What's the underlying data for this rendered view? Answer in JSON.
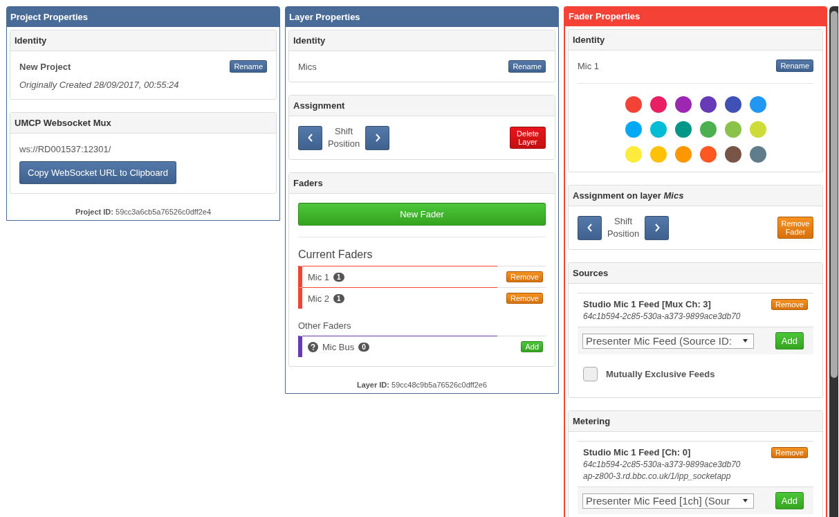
{
  "project": {
    "title": "Project Properties",
    "identity": {
      "title": "Identity",
      "name": "New Project",
      "created": "Originally Created 28/09/2017, 00:55:24",
      "button": "Rename"
    },
    "mux": {
      "title": "UMCP Websocket Mux",
      "url": "ws://RD001537:12301/",
      "button": "Copy WebSocket URL to Clipboard"
    },
    "footer": {
      "label": "Project ID:",
      "value": "59cc3a6cb5a76526c0dff2e4"
    }
  },
  "layer": {
    "title": "Layer Properties",
    "identity": {
      "title": "Identity",
      "name": "Mics",
      "button": "Rename"
    },
    "assignment": {
      "title": "Assignment",
      "shift_label": "Shift Position",
      "action": "Delete Layer"
    },
    "faders": {
      "title": "Faders",
      "new_button": "New Fader",
      "current_title": "Current Faders",
      "current": [
        {
          "name": "Mic 1",
          "count": "1",
          "color": "#f44336",
          "button": "Remove"
        },
        {
          "name": "Mic 2",
          "count": "1",
          "color": "#f44336",
          "button": "Remove"
        }
      ],
      "other_title": "Other Faders",
      "other": [
        {
          "name": "Mic Bus",
          "count": "0",
          "color": "#673ab7",
          "button": "Add"
        }
      ]
    },
    "footer": {
      "label": "Layer ID:",
      "value": "59cc48c9b5a76526c0dff2e6"
    }
  },
  "fader": {
    "title": "Fader Properties",
    "identity": {
      "title": "Identity",
      "name": "Mic 1",
      "button": "Rename",
      "colors": [
        {
          "color": "#f44336"
        },
        {
          "color": "#e91e63"
        },
        {
          "color": "#9c27b0"
        },
        {
          "color": "#673ab7"
        },
        {
          "color": "#3f51b5"
        },
        {
          "color": "#2196f3"
        },
        {
          "color": "#03a9f4"
        },
        {
          "color": "#00bcd4"
        },
        {
          "color": "#009688"
        },
        {
          "color": "#4caf50"
        },
        {
          "color": "#8bc34a"
        },
        {
          "color": "#cddc39"
        },
        {
          "color": "#ffeb3b"
        },
        {
          "color": "#ffc107"
        },
        {
          "color": "#ff9800"
        },
        {
          "color": "#ff5722"
        },
        {
          "color": "#795548"
        },
        {
          "color": "#607d8b"
        }
      ]
    },
    "assignment": {
      "title": "Assignment on layer *Mics*",
      "shift_label": "Shift Position",
      "action": "Remove Fader"
    },
    "sources": {
      "title": "Sources",
      "items": [
        {
          "name": "Studio Mic 1 Feed [Mux Ch: 3]",
          "lines": [
            "64c1b594-2c85-530a-a373-9899ace3db70"
          ],
          "button": "Remove"
        }
      ],
      "select": "Presenter Mic Feed (Source ID:",
      "add_button": "Add",
      "checkbox": {
        "label": "Mutually Exclusive Feeds",
        "checked": false
      }
    },
    "metering": {
      "title": "Metering",
      "items": [
        {
          "name": "Studio Mic 1 Feed [Ch: 0]",
          "lines": [
            "64c1b594-2c85-530a-a373-9899ace3db70",
            "ap-z800-3.rd.bbc.co.uk/1/ipp_socketapp"
          ],
          "button": "Remove"
        }
      ],
      "select": "Presenter Mic Feed [1ch] (Sour",
      "add_button": "Add"
    }
  }
}
